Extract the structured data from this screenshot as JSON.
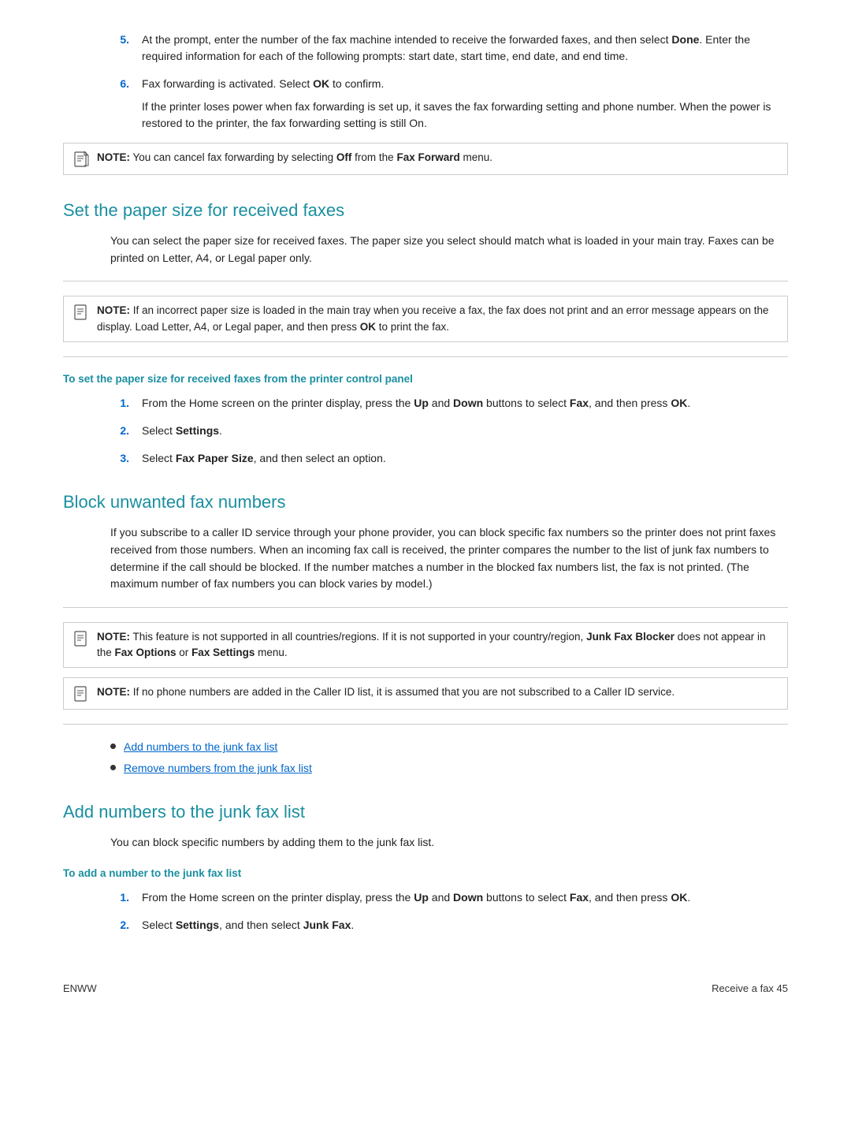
{
  "steps_top": [
    {
      "num": "5.",
      "text_parts": [
        {
          "text": "At the prompt, enter the number of the fax machine intended to receive the forwarded faxes, and then select "
        },
        {
          "text": "Done",
          "bold": true
        },
        {
          "text": ". Enter the required information for each of the following prompts: start date, start time, end date, and end time."
        }
      ]
    },
    {
      "num": "6.",
      "text_parts": [
        {
          "text": "Fax forwarding is activated. Select "
        },
        {
          "text": "OK",
          "bold": true
        },
        {
          "text": " to confirm."
        }
      ],
      "sub_para": "If the printer loses power when fax forwarding is set up, it saves the fax forwarding setting and phone number. When the power is restored to the printer, the fax forwarding setting is still On."
    }
  ],
  "note_fax_forward": {
    "label": "NOTE:",
    "text_parts": [
      {
        "text": "   You can cancel fax forwarding by selecting "
      },
      {
        "text": "Off",
        "bold": true
      },
      {
        "text": " from the "
      },
      {
        "text": "Fax Forward",
        "bold": true
      },
      {
        "text": " menu."
      }
    ]
  },
  "section_paper_size": {
    "heading": "Set the paper size for received faxes",
    "body": "You can select the paper size for received faxes. The paper size you select should match what is loaded in your main tray. Faxes can be printed on Letter, A4, or Legal paper only.",
    "note": {
      "label": "NOTE:",
      "text_parts": [
        {
          "text": "   If an incorrect paper size is loaded in the main tray when you receive a fax, the fax does not print and an error message appears on the display. Load Letter, A4, or Legal paper, and then press "
        },
        {
          "text": "OK",
          "bold": true
        },
        {
          "text": " to print the fax."
        }
      ]
    },
    "sub_heading": "To set the paper size for received faxes from the printer control panel",
    "steps": [
      {
        "num": "1.",
        "text_parts": [
          {
            "text": "From the Home screen on the printer display, press the "
          },
          {
            "text": "Up",
            "bold": true
          },
          {
            "text": " and "
          },
          {
            "text": "Down",
            "bold": true
          },
          {
            "text": " buttons to select "
          },
          {
            "text": "Fax",
            "bold": true
          },
          {
            "text": ", and then press "
          },
          {
            "text": "OK",
            "bold": true
          },
          {
            "text": "."
          }
        ]
      },
      {
        "num": "2.",
        "text_parts": [
          {
            "text": "Select "
          },
          {
            "text": "Settings",
            "bold": true
          },
          {
            "text": "."
          }
        ]
      },
      {
        "num": "3.",
        "text_parts": [
          {
            "text": "Select "
          },
          {
            "text": "Fax Paper Size",
            "bold": true
          },
          {
            "text": ", and then select an option."
          }
        ]
      }
    ]
  },
  "section_block": {
    "heading": "Block unwanted fax numbers",
    "body": "If you subscribe to a caller ID service through your phone provider, you can block specific fax numbers so the printer does not print faxes received from those numbers. When an incoming fax call is received, the printer compares the number to the list of junk fax numbers to determine if the call should be blocked. If the number matches a number in the blocked fax numbers list, the fax is not printed. (The maximum number of fax numbers you can block varies by model.)",
    "note1": {
      "label": "NOTE:",
      "text_parts": [
        {
          "text": "   This feature is not supported in all countries/regions. If it is not supported in your country/region, "
        },
        {
          "text": "Junk Fax Blocker",
          "bold": true
        },
        {
          "text": " does not appear in the "
        },
        {
          "text": "Fax Options",
          "bold": true
        },
        {
          "text": " or "
        },
        {
          "text": "Fax Settings",
          "bold": true
        },
        {
          "text": " menu."
        }
      ]
    },
    "note2": {
      "label": "NOTE:",
      "text_parts": [
        {
          "text": "   If no phone numbers are added in the Caller ID list, it is assumed that you are not subscribed to a Caller ID service."
        }
      ]
    },
    "links": [
      {
        "text": "Add numbers to the junk fax list"
      },
      {
        "text": "Remove numbers from the junk fax list"
      }
    ]
  },
  "section_add": {
    "heading": "Add numbers to the junk fax list",
    "body": "You can block specific numbers by adding them to the junk fax list.",
    "sub_heading": "To add a number to the junk fax list",
    "steps": [
      {
        "num": "1.",
        "text_parts": [
          {
            "text": "From the Home screen on the printer display, press the "
          },
          {
            "text": "Up",
            "bold": true
          },
          {
            "text": " and "
          },
          {
            "text": "Down",
            "bold": true
          },
          {
            "text": " buttons to select "
          },
          {
            "text": "Fax",
            "bold": true
          },
          {
            "text": ", and then press "
          },
          {
            "text": "OK",
            "bold": true
          },
          {
            "text": "."
          }
        ]
      },
      {
        "num": "2.",
        "text_parts": [
          {
            "text": "Select "
          },
          {
            "text": "Settings",
            "bold": true
          },
          {
            "text": ", and then select "
          },
          {
            "text": "Junk Fax",
            "bold": true
          },
          {
            "text": "."
          }
        ]
      }
    ]
  },
  "footer": {
    "left": "ENWW",
    "right": "Receive a fax    45"
  }
}
